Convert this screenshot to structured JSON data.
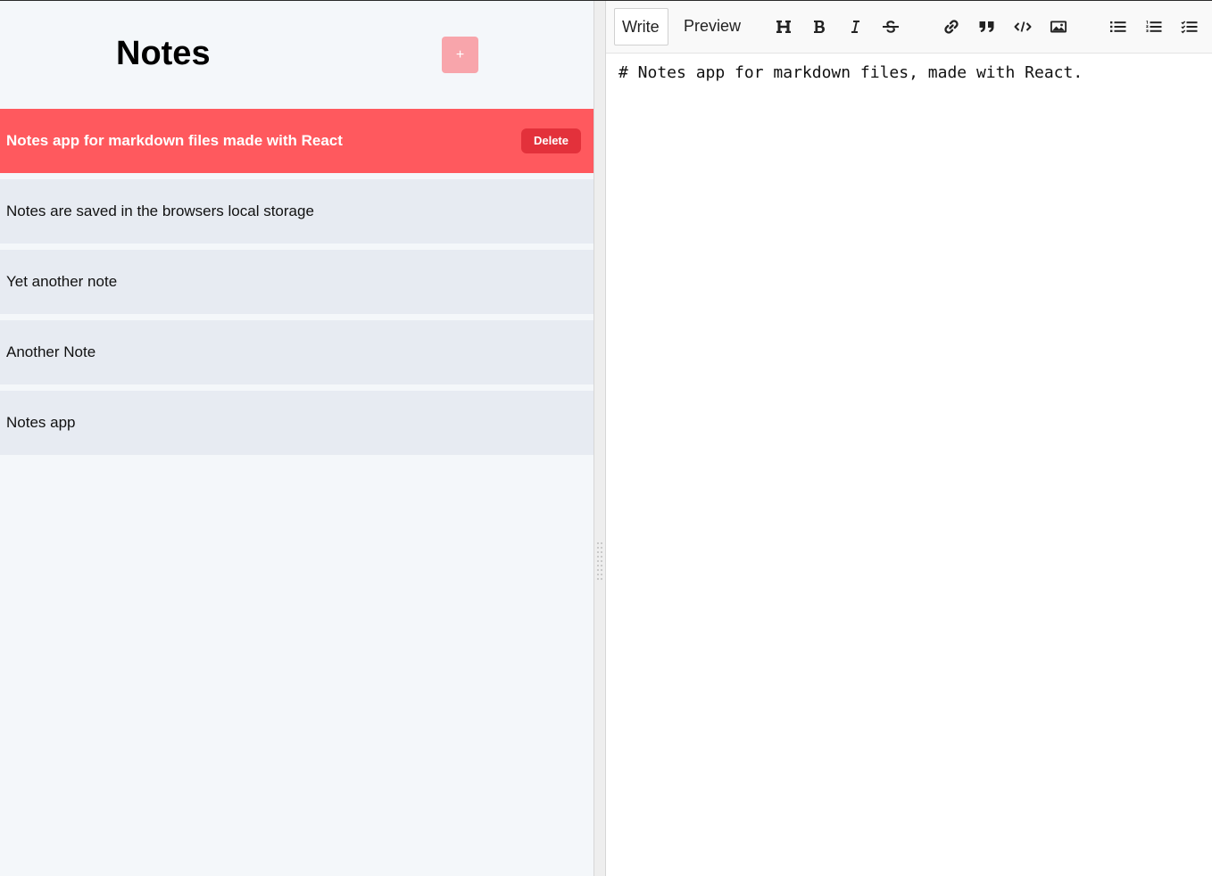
{
  "sidebar": {
    "title": "Notes",
    "add_label": "+",
    "delete_label": "Delete",
    "notes": [
      {
        "title": "Notes app for markdown files made with React",
        "selected": true
      },
      {
        "title": "Notes are saved in the browsers local storage",
        "selected": false
      },
      {
        "title": "Yet another note",
        "selected": false
      },
      {
        "title": "Another Note",
        "selected": false
      },
      {
        "title": "Notes app",
        "selected": false
      }
    ]
  },
  "editor": {
    "tabs": {
      "write": "Write",
      "preview": "Preview"
    },
    "active_tab": "write",
    "toolbar_icons": [
      "header-icon",
      "bold-icon",
      "italic-icon",
      "strikethrough-icon",
      "link-icon",
      "quote-icon",
      "code-icon",
      "image-icon",
      "unordered-list-icon",
      "ordered-list-icon",
      "checked-list-icon"
    ],
    "content": "# Notes app for markdown files, made with React."
  },
  "colors": {
    "accent": "#ff595e",
    "delete_button": "#e3313b",
    "add_button": "#f8a5ab",
    "note_background": "#e7ebf2",
    "sidebar_background": "#f4f7fa"
  }
}
